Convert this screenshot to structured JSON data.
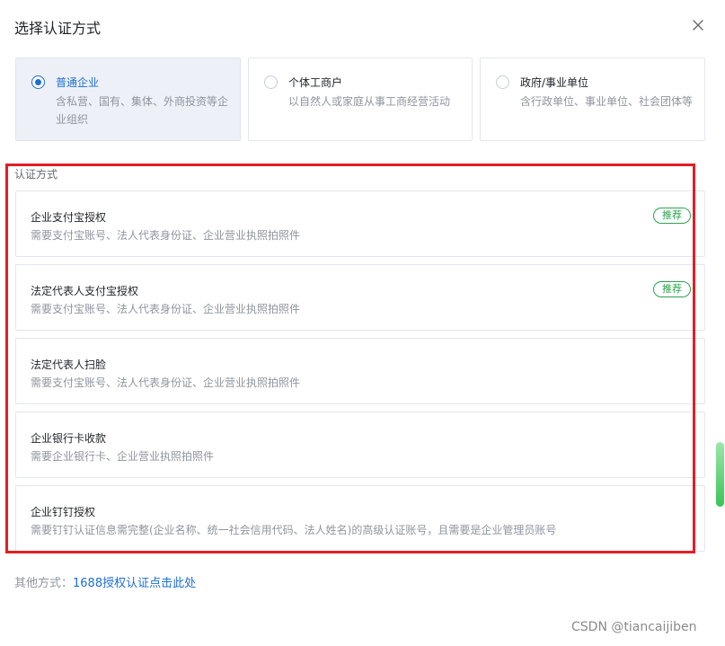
{
  "dialog": {
    "title": "选择认证方式"
  },
  "entity_types": [
    {
      "label": "普通企业",
      "desc": "含私营、国有、集体、外商投资等企业组织",
      "selected": true
    },
    {
      "label": "个体工商户",
      "desc": "以自然人或家庭从事工商经营活动",
      "selected": false
    },
    {
      "label": "政府/事业单位",
      "desc": "含行政单位、事业单位、社会团体等",
      "selected": false
    }
  ],
  "methods_section": {
    "label": "认证方式",
    "items": [
      {
        "title": "企业支付宝授权",
        "desc": "需要支付宝账号、法人代表身份证、企业营业执照拍照件",
        "badge": "推荐"
      },
      {
        "title": "法定代表人支付宝授权",
        "desc": "需要支付宝账号、法人代表身份证、企业营业执照拍照件",
        "badge": "推荐"
      },
      {
        "title": "法定代表人扫脸",
        "desc": "需要支付宝账号、法人代表身份证、企业营业执照拍照件"
      },
      {
        "title": "企业银行卡收款",
        "desc": "需要企业银行卡、企业营业执照拍照件"
      },
      {
        "title": "企业钉钉授权",
        "desc": "需要钉钉认证信息需完整(企业名称、统一社会信用代码、法人姓名)的高级认证账号，且需要是企业管理员账号"
      }
    ]
  },
  "other": {
    "prefix": "其他方式：",
    "link": "1688授权认证点击此处"
  },
  "watermark": "CSDN @tiancaijiben",
  "colors": {
    "accent": "#1d6ed6",
    "recommend": "#2ba24c",
    "highlight": "#e31e24",
    "scrollbar": "#39c558"
  }
}
